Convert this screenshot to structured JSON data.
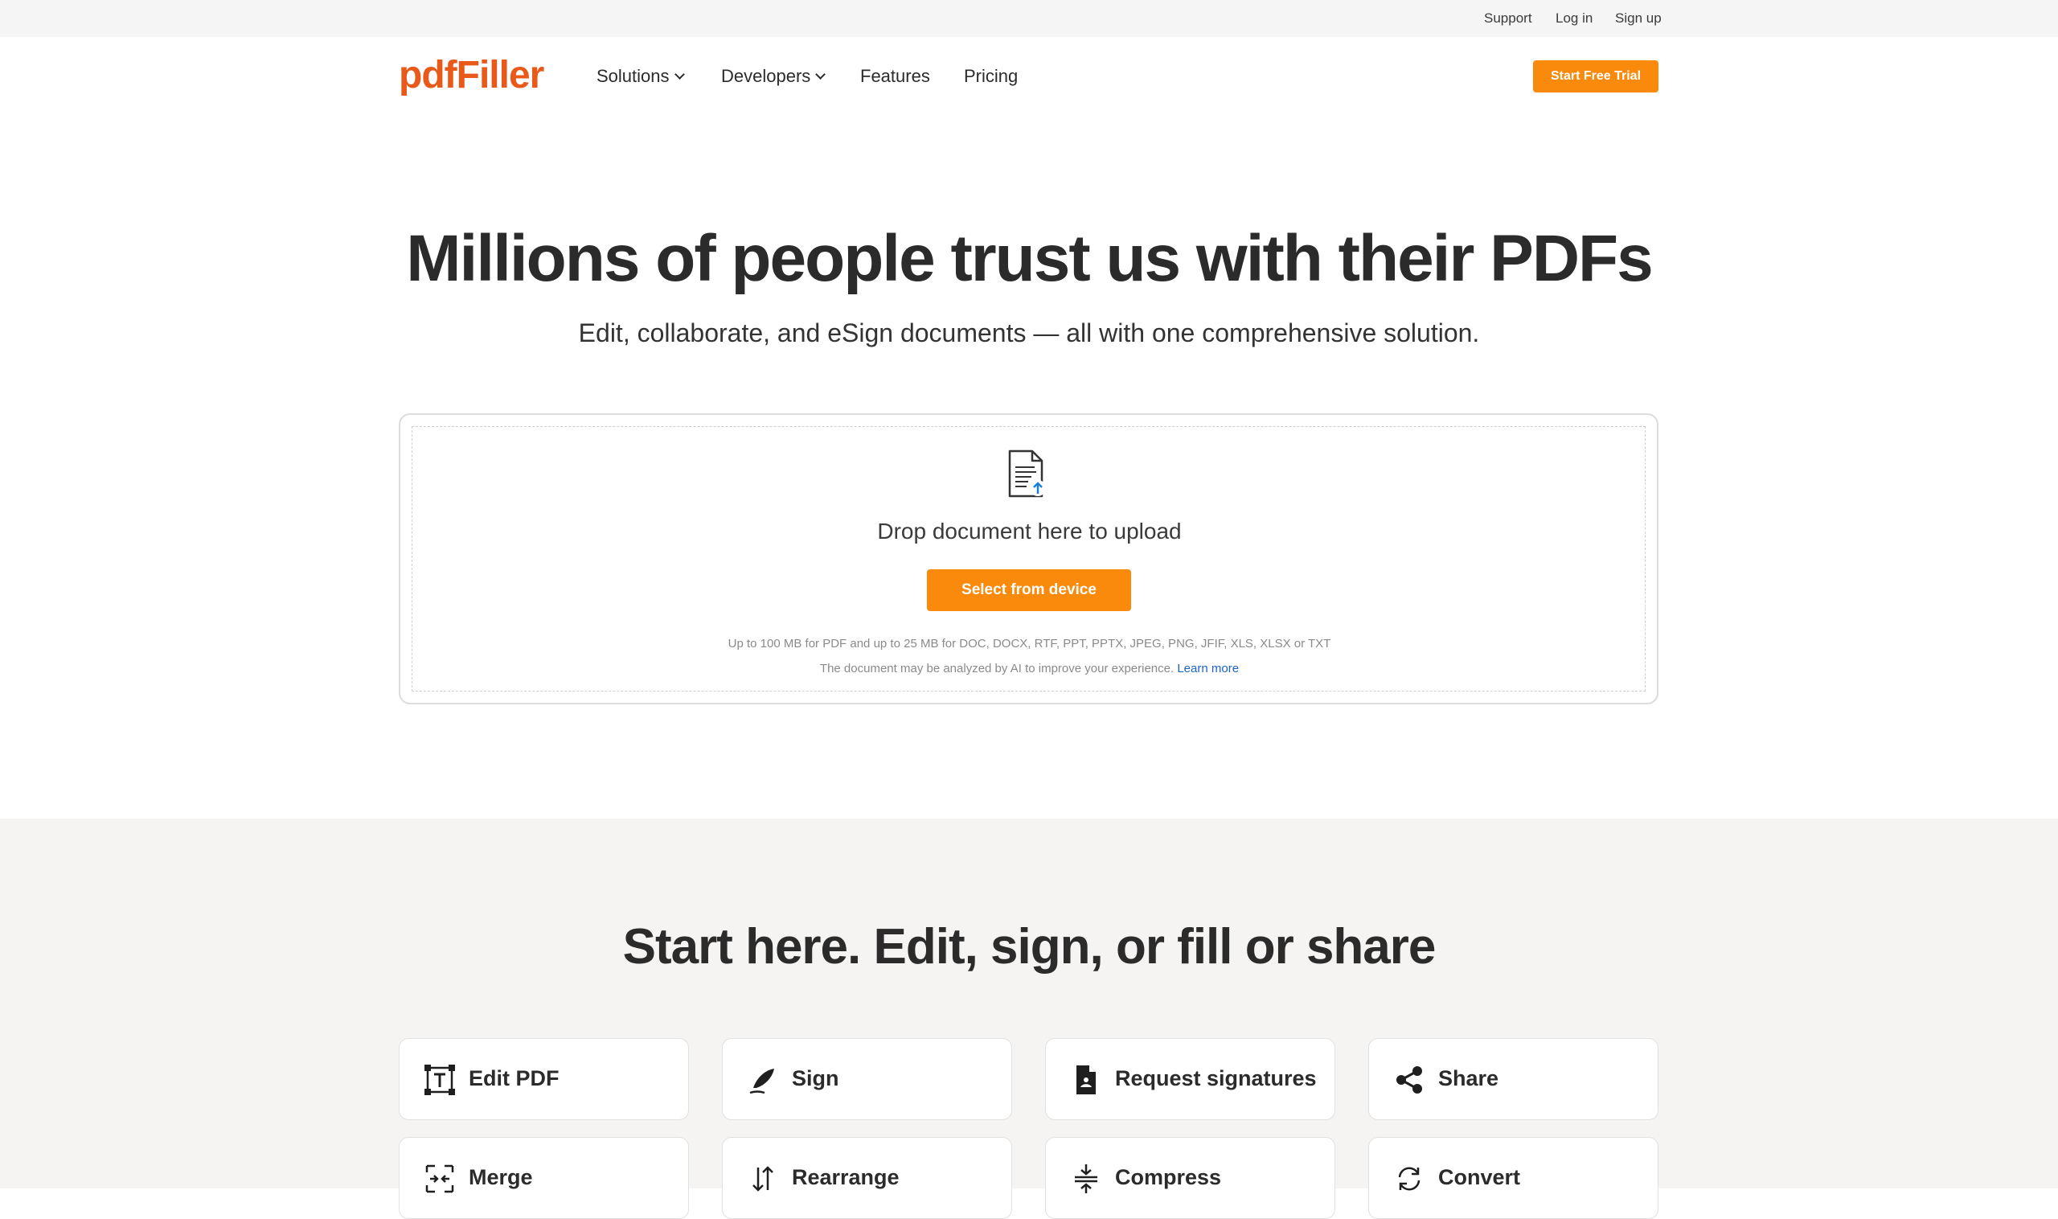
{
  "topbar": {
    "support": "Support",
    "login": "Log in",
    "signup": "Sign up"
  },
  "header": {
    "logo": "pdfFiller",
    "nav": {
      "solutions": "Solutions",
      "developers": "Developers",
      "features": "Features",
      "pricing": "Pricing"
    },
    "cta": "Start Free Trial"
  },
  "hero": {
    "title": "Millions of people trust us with their PDFs",
    "subtitle": "Edit, collaborate, and eSign documents — all with one comprehensive solution."
  },
  "upload": {
    "icon": "document-upload-icon",
    "drop_text": "Drop document here to upload",
    "button": "Select from device",
    "limits": "Up to 100 MB for PDF and up to 25 MB for DOC, DOCX, RTF, PPT, PPTX, JPEG, PNG, JFIF, XLS, XLSX or TXT",
    "ai_note": "The document may be analyzed by AI to improve your experience.",
    "learn_more": "Learn more"
  },
  "features": {
    "title": "Start here. Edit, sign, or fill or share",
    "cards": [
      {
        "label": "Edit PDF",
        "icon": "edit-text-icon"
      },
      {
        "label": "Sign",
        "icon": "pen-nib-icon"
      },
      {
        "label": "Request signatures",
        "icon": "signature-request-icon"
      },
      {
        "label": "Share",
        "icon": "share-icon"
      },
      {
        "label": "Merge",
        "icon": "merge-icon"
      },
      {
        "label": "Rearrange",
        "icon": "rearrange-icon"
      },
      {
        "label": "Compress",
        "icon": "compress-icon"
      },
      {
        "label": "Convert",
        "icon": "convert-icon"
      }
    ]
  },
  "colors": {
    "brand": "#e8591a",
    "accent": "#f98a0b",
    "link": "#1c64c9",
    "section_bg": "#f5f4f2"
  }
}
